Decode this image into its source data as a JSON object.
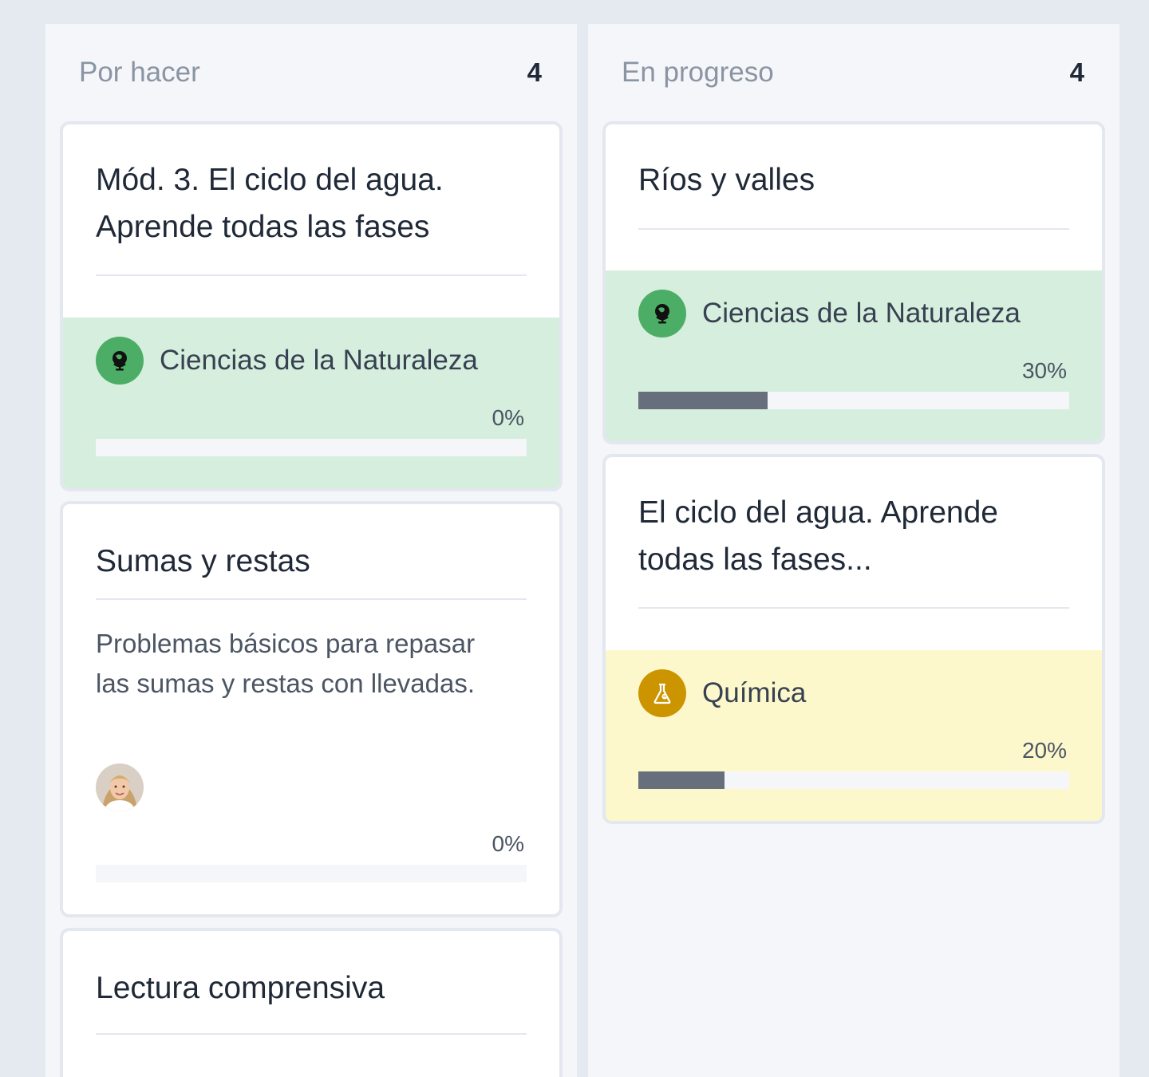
{
  "columns": [
    {
      "title": "Por hacer",
      "count": "4",
      "cards": [
        {
          "title_line1": "Mód. 3. El ciclo del agua.",
          "title_line2": "Aprende todas las fases",
          "subject": "Ciencias de la Naturaleza",
          "subject_icon": "globe-icon",
          "subject_color": "#4cae66",
          "area_color": "#d6eedd",
          "progress_label": "0%",
          "progress": 0
        },
        {
          "title": "Sumas y restas",
          "description_line1": "Problemas básicos para repasar",
          "description_line2": "las sumas y restas con llevadas.",
          "progress_label": "0%",
          "progress": 0
        },
        {
          "title": "Lectura comprensiva"
        }
      ]
    },
    {
      "title": "En progreso",
      "count": "4",
      "cards": [
        {
          "title": "Ríos y valles",
          "subject": "Ciencias de la Naturaleza",
          "subject_icon": "globe-icon",
          "subject_color": "#4cae66",
          "area_color": "#d6eedd",
          "progress_label": "30%",
          "progress": 0.3
        },
        {
          "title_line1": "El ciclo del agua. Aprende",
          "title_line2": "todas las fases...",
          "subject": "Química",
          "subject_icon": "flask-icon",
          "subject_color": "#cc9500",
          "area_color": "#fdf8cc",
          "progress_label": "20%",
          "progress": 0.2
        }
      ]
    }
  ]
}
